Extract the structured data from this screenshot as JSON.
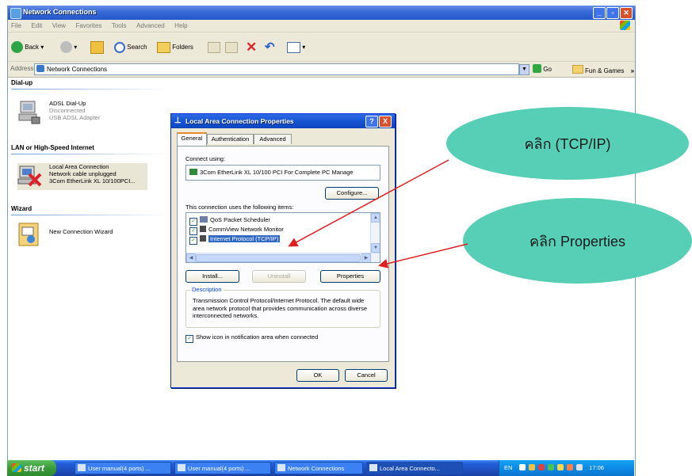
{
  "window": {
    "title": "Network Connections",
    "menu": [
      "File",
      "Edit",
      "View",
      "Favorites",
      "Tools",
      "Advanced",
      "Help"
    ]
  },
  "toolbar": {
    "back_label": "Back",
    "search_label": "Search",
    "folders_label": "Folders"
  },
  "address": {
    "label": "Address",
    "value": "Network Connections",
    "go_label": "Go",
    "links_label": "Fun & Games",
    "more": "»"
  },
  "groups": {
    "dialup": {
      "header": "Dial-up",
      "item": {
        "name": "ADSL Dial-Up",
        "status": "Disconnected",
        "device": "USB ADSL Adapter"
      }
    },
    "lan": {
      "header": "LAN or High-Speed Internet",
      "item": {
        "name": "Local Area Connection",
        "status": "Network cable unplugged",
        "device": "3Com EtherLink XL 10/100PCI..."
      }
    },
    "wizard": {
      "header": "Wizard",
      "item": {
        "name": "New Connection Wizard"
      }
    }
  },
  "dialog": {
    "title": "Local Area Connection Properties",
    "help_btn": "?",
    "close_btn": "X",
    "tabs": [
      "General",
      "Authentication",
      "Advanced"
    ],
    "connect_using_label": "Connect using:",
    "adapter": "3Com EtherLink XL 10/100 PCI For Complete PC Manage",
    "configure_label": "Configure...",
    "items_label": "This connection uses the following items:",
    "items": [
      "QoS Packet Scheduler",
      "CommView Network Monitor",
      "Internet Protocol (TCP/IP)"
    ],
    "install_label": "Install...",
    "uninstall_label": "Uninstall",
    "properties_label": "Properties",
    "description_legend": "Description",
    "description_text": "Transmission Control Protocol/Internet Protocol. The default wide area network protocol that provides communication across diverse interconnected networks.",
    "show_icon_label": "Show icon in notification area when connected",
    "ok_label": "OK",
    "cancel_label": "Cancel"
  },
  "callouts": {
    "tcpip": "คลิก (TCP/IP)",
    "properties": "คลิก Properties"
  },
  "taskbar": {
    "start_label": "start",
    "tasks": [
      "User manual(4 ports) ...",
      "User manual(4 ports) ...",
      "Network Connections",
      "Local Area Connecto..."
    ],
    "lang": "EN",
    "clock": "17:06"
  },
  "colors": {
    "callout": "#56cfb6",
    "arrow": "#e02020",
    "selection": "#316ac5",
    "titlebar": "#245edb"
  }
}
